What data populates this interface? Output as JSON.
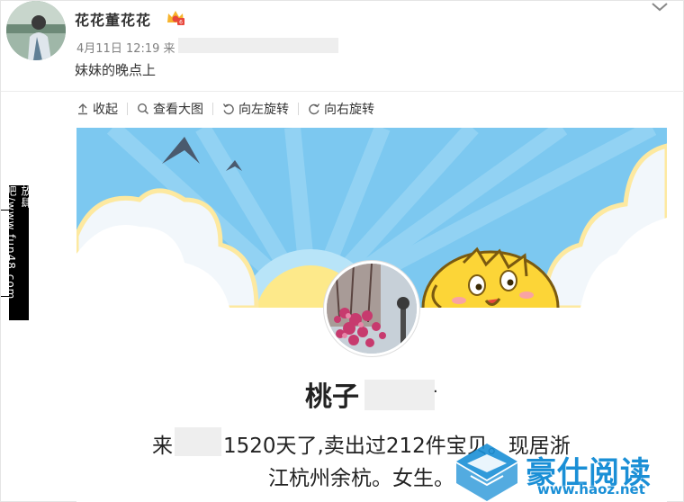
{
  "post": {
    "user_name": "花花董花花",
    "meta_prefix": "4月11日 12:19 来",
    "text": "妹妹的晚点上"
  },
  "toolbar": {
    "collapse": "收起",
    "view_large": "查看大图",
    "rotate_left": "向左旋转",
    "rotate_right": "向右旋转"
  },
  "watermark_left": "放肆吧/www.fun48.com",
  "screenshot": {
    "shop_name": "桃子",
    "name_tail": "·",
    "desc_prefix": "来",
    "desc_line1_rest": "1520天了,卖出过212件宝贝。现居浙",
    "desc_line2": "江杭州余杭。女生。"
  },
  "brand_watermark": {
    "title": "豪仕阅读",
    "url": "www.haoz.net"
  },
  "colors": {
    "sky": "#7cc8f0",
    "brand_blue": "#1a8fd6",
    "sun": "#fde98a"
  }
}
